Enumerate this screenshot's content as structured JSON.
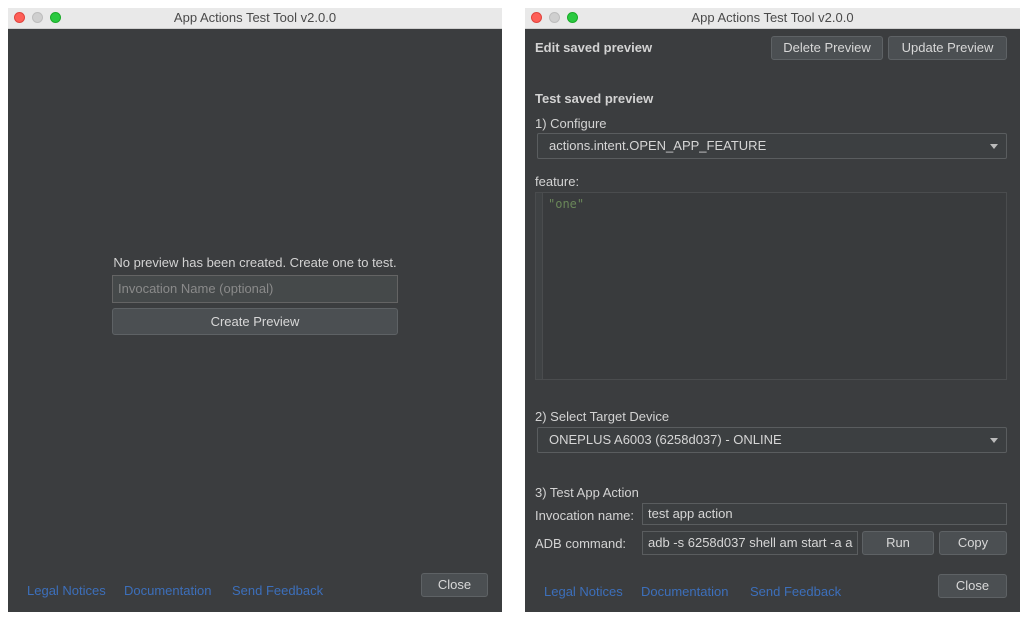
{
  "left_window": {
    "title": "App Actions Test Tool v2.0.0",
    "empty_message": "No preview has been created. Create one to test.",
    "invocation_placeholder": "Invocation Name (optional)",
    "create_preview_label": "Create Preview",
    "footer_links": [
      "Legal Notices",
      "Documentation",
      "Send Feedback"
    ],
    "close_label": "Close"
  },
  "right_window": {
    "title": "App Actions Test Tool v2.0.0",
    "edit_heading": "Edit saved preview",
    "delete_preview_label": "Delete Preview",
    "update_preview_label": "Update Preview",
    "test_heading": "Test saved preview",
    "step1_label": "1) Configure",
    "intent_value": "actions.intent.OPEN_APP_FEATURE",
    "feature_label": "feature:",
    "feature_value": "\"one\"",
    "step2_label": "2) Select Target Device",
    "device_value": "ONEPLUS A6003 (6258d037) - ONLINE",
    "step3_label": "3) Test App Action",
    "invocation_name_label": "Invocation name:",
    "invocation_name_value": "test app action",
    "adb_command_label": "ADB command:",
    "adb_command_value": "adb -s 6258d037 shell am start -a a",
    "run_label": "Run",
    "copy_label": "Copy",
    "footer_links": [
      "Legal Notices",
      "Documentation",
      "Send Feedback"
    ],
    "close_label": "Close"
  },
  "colors": {
    "window_bg": "#3b3d3f",
    "link": "#3c6fbb",
    "feature_value": "#6a8759"
  },
  "icons": [
    "close-window-icon",
    "minimize-window-icon",
    "zoom-window-icon",
    "dropdown-arrow-icon"
  ]
}
